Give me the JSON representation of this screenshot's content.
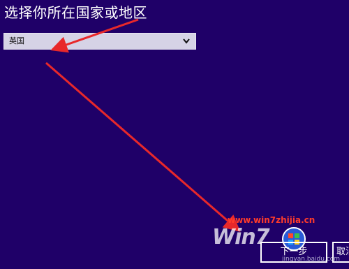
{
  "page": {
    "title": "选择你所在国家或地区"
  },
  "country_select": {
    "value": "英国",
    "icon": "chevron-down-icon"
  },
  "buttons": {
    "next_label": "下一步",
    "cancel_label": "取消"
  },
  "watermark": {
    "url": "www.win7zhijia.cn",
    "logo_text": "Win7",
    "sub_text": "jingyan.baidu.com"
  },
  "annotation": {
    "arrow_color": "#e8282a"
  },
  "colors": {
    "background": "#1f0068",
    "select_background": "#d6d3e6"
  }
}
